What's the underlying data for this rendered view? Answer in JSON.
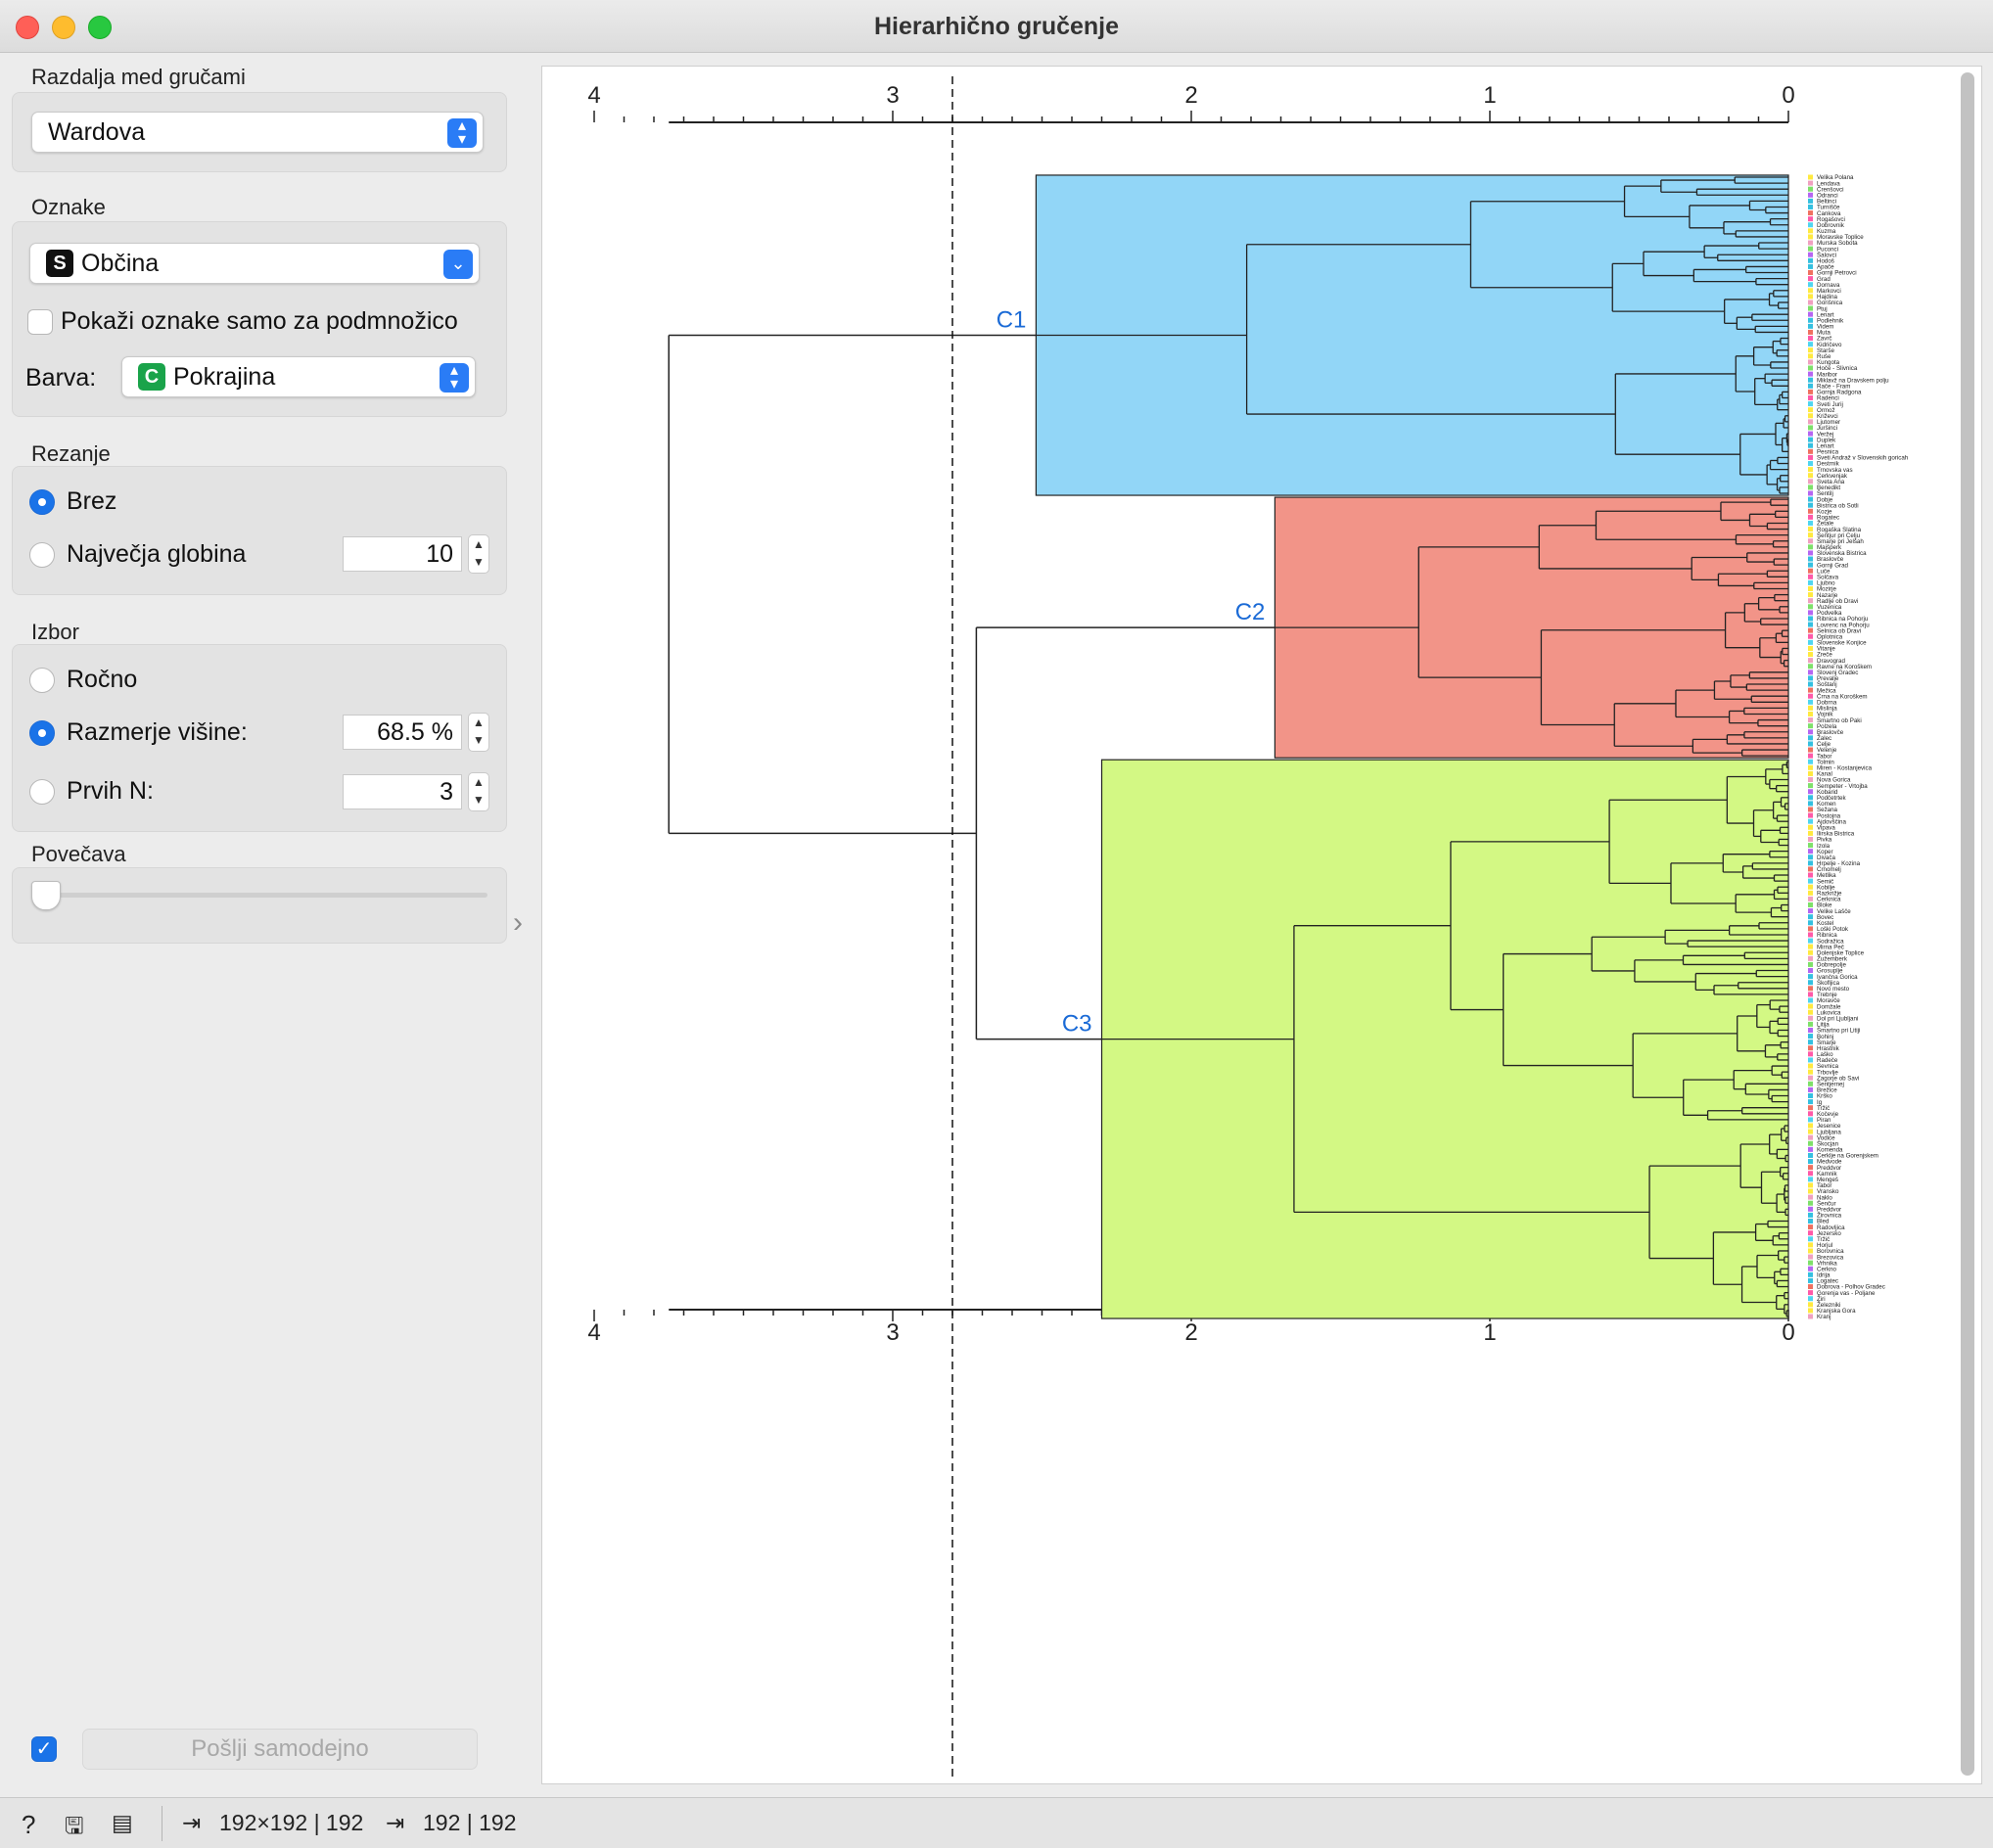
{
  "window": {
    "title": "Hierarhično gručenje"
  },
  "sidebar": {
    "linkage": {
      "label": "Razdalja med gručami",
      "value": "Wardova"
    },
    "annotations": {
      "label": "Oznake",
      "value": "Občina",
      "value_type_icon": "S",
      "subset_checkbox_label": "Pokaži oznake samo za podmnožico",
      "subset_checked": false,
      "color_label": "Barva:",
      "color_value": "Pokrajina",
      "color_type_icon": "C"
    },
    "pruning": {
      "label": "Rezanje",
      "none_label": "Brez",
      "max_depth_label": "Največja globina",
      "max_depth_value": "10",
      "selected": "none"
    },
    "selection": {
      "label": "Izbor",
      "manual_label": "Ročno",
      "height_ratio_label": "Razmerje višine:",
      "height_ratio_value": "68.5 %",
      "top_n_label": "Prvih N:",
      "top_n_value": "3",
      "selected": "height_ratio"
    },
    "zoom": {
      "label": "Povečava",
      "value": 0
    },
    "auto_send": {
      "label": "Pošlji samodejno",
      "checked": true
    }
  },
  "dendrogram": {
    "axis_ticks": [
      "4",
      "3",
      "2",
      "1",
      "0"
    ],
    "cut_height": 2.8,
    "clusters": [
      {
        "name": "C1",
        "color": "#92d6f7",
        "count": 54
      },
      {
        "name": "C2",
        "color": "#f29488",
        "count": 44
      },
      {
        "name": "C3",
        "color": "#d3f884",
        "count": 94
      }
    ],
    "leaf_labels": [
      "Velika Polana",
      "Lendava",
      "Črenšovci",
      "Odranci",
      "Beltinci",
      "Turnišče",
      "Cankova",
      "Rogašovci",
      "Dobrovnik",
      "Kuzma",
      "Moravske Toplice",
      "Murska Sobota",
      "Puconci",
      "Šalovci",
      "Hodoš",
      "Apače",
      "Gornji Petrovci",
      "Grad",
      "Dornava",
      "Markovci",
      "Hajdina",
      "Gorišnica",
      "Ptuj",
      "Lenart",
      "Podlehnik",
      "Videm",
      "Muta",
      "Zavrč",
      "Kidričevo",
      "Starše",
      "Ruše",
      "Kungota",
      "Hoče - Slivnica",
      "Maribor",
      "Miklavž na Dravskem polju",
      "Rače - Fram",
      "Gornja Radgona",
      "Radenci",
      "Sveti Jurij",
      "Ormož",
      "Križevci",
      "Ljutomer",
      "Juršinci",
      "Veržej",
      "Duplek",
      "Lenart",
      "Pesnica",
      "Sveti Andraž v Slovenskih goricah",
      "Destrnik",
      "Trnovska vas",
      "Cerkvenjak",
      "Sveta Ana",
      "Benedikt",
      "Šentilj",
      "Dobje",
      "Bistrica ob Sotli",
      "Kozje",
      "Rogatec",
      "Žetale",
      "Rogaška Slatina",
      "Šentjur pri Celju",
      "Šmarje pri Jelšah",
      "Majšperk",
      "Slovenska Bistrica",
      "Braslovče",
      "Gornji Grad",
      "Luče",
      "Solčava",
      "Ljubno",
      "Mozirje",
      "Nazarje",
      "Radlje ob Dravi",
      "Vuzenica",
      "Podvelka",
      "Ribnica na Pohorju",
      "Lovrenc na Pohorju",
      "Selnica ob Dravi",
      "Oplotnica",
      "Slovenske Konjice",
      "Vitanje",
      "Zreče",
      "Dravograd",
      "Ravne na Koroškem",
      "Slovenj Gradec",
      "Prevalje",
      "Šoštanj",
      "Mežica",
      "Črna na Koroškem",
      "Dobrna",
      "Mislinja",
      "Vojnik",
      "Šmartno ob Paki",
      "Polzela",
      "Braslovče",
      "Žalec",
      "Celje",
      "Velenje",
      "Tabor",
      "Tolmin",
      "Miren - Kostanjevica",
      "Kanal",
      "Nova Gorica",
      "Šempeter - Vrtojba",
      "Kobarid",
      "Podčetrtek",
      "Komen",
      "Sežana",
      "Postojna",
      "Ajdovščina",
      "Vipava",
      "Ilirska Bistrica",
      "Pivka",
      "Izola",
      "Koper",
      "Divača",
      "Hrpelje - Kozina",
      "Črnomelj",
      "Metlika",
      "Semič",
      "Kobilje",
      "Razkrižje",
      "Cerknica",
      "Bloke",
      "Velike Lašče",
      "Bovec",
      "Kostel",
      "Loški Potok",
      "Ribnica",
      "Sodražica",
      "Mirna Peč",
      "Dolenjske Toplice",
      "Žužemberk",
      "Dobrepolje",
      "Grosuplje",
      "Ivančna Gorica",
      "Škofljica",
      "Novo mesto",
      "Trebnje",
      "Moravče",
      "Domžale",
      "Lukovica",
      "Dol pri Ljubljani",
      "Litija",
      "Šmartno pri Litiji",
      "Bohinj",
      "Šmarje",
      "Hrastnik",
      "Laško",
      "Radeče",
      "Sevnica",
      "Trbovlje",
      "Zagorje ob Savi",
      "Šentjernej",
      "Brežice",
      "Krško",
      "Ig",
      "Tržič",
      "Kočevje",
      "Piran",
      "Jesenice",
      "Ljubljana",
      "Vodice",
      "Škocjan",
      "Komenda",
      "Cerklje na Gorenjskem",
      "Medvode",
      "Preddvor",
      "Kamnik",
      "Mengeš",
      "Tabor",
      "Vransko",
      "Naklo",
      "Šenčur",
      "Preddvor",
      "Žirovnica",
      "Bled",
      "Radovljica",
      "Jezersko",
      "Tržič",
      "Horjul",
      "Borovnica",
      "Brezovica",
      "Vrhnika",
      "Cerkno",
      "Idrija",
      "Logatec",
      "Dobrova - Polhov Gradec",
      "Gorenja vas - Poljane",
      "Žiri",
      "Železniki",
      "Kranjska Gora",
      "Kranj",
      "Škofja Loka"
    ],
    "region_colors": [
      "#ffe940",
      "#4fd5f0",
      "#ff5aa8",
      "#f07060",
      "#35c0e0",
      "#b566f2",
      "#7ee06a",
      "#f0a0c0"
    ]
  },
  "statusbar": {
    "input_summary": "192×192 | 192",
    "output_summary": "192 | 192"
  }
}
